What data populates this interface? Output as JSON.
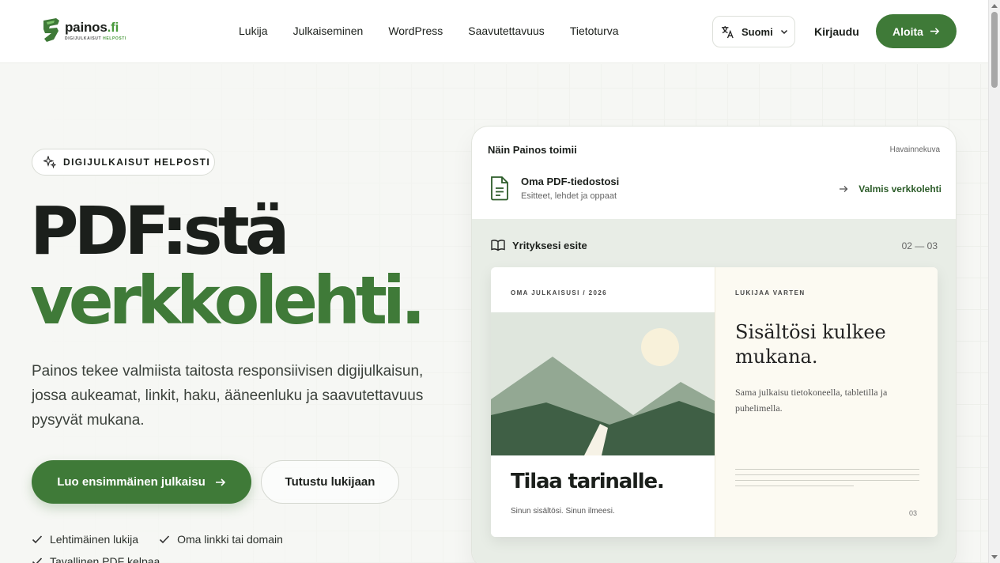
{
  "brand": {
    "name": "painos",
    "tld": ".fi",
    "tagline_a": "DIGIJULKAISUT",
    "tagline_b": "HELPOSTI",
    "accent": "#3f7a38"
  },
  "nav": {
    "items": [
      "Lukija",
      "Julkaiseminen",
      "WordPress",
      "Saavutettavuus",
      "Tietoturva"
    ],
    "language": "Suomi",
    "login": "Kirjaudu",
    "start": "Aloita"
  },
  "hero": {
    "badge": "DIGIJULKAISUT HELPOSTI",
    "headline_1": "PDF:stä",
    "headline_2": "verkkolehti.",
    "lead": "Painos tekee valmiista taitosta responsiivisen digijulkaisun, jossa aukeamat, linkit, haku, ääneenluku ja saavutettavuus pysyvät mukana.",
    "cta_primary": "Luo ensimmäinen julkaisu",
    "cta_secondary": "Tutustu lukijaan",
    "checks": [
      "Lehtimäinen lukija",
      "Oma linkki tai domain",
      "Tavallinen PDF kelpaa"
    ]
  },
  "preview": {
    "title": "Näin Painos toimii",
    "tag": "Havainnekuva",
    "file_name": "Oma PDF-tiedostosi",
    "file_sub": "Esitteet, lehdet ja oppaat",
    "ready": "Valmis verkkolehti",
    "stage_title": "Yrityksesi esite",
    "stage_pages": "02 — 03",
    "left_kicker": "OMA JULKAISUSI / 2026",
    "story_title": "Tilaa tarinalle.",
    "story_sub": "Sinun sisältösi. Sinun ilmeesi.",
    "right_kicker": "LUKIJAA VARTEN",
    "right_title": "Sisältösi kulkee mukana.",
    "right_text": "Sama julkaisu tietokoneella, tabletilla ja puhelimella.",
    "page_number": "03"
  }
}
